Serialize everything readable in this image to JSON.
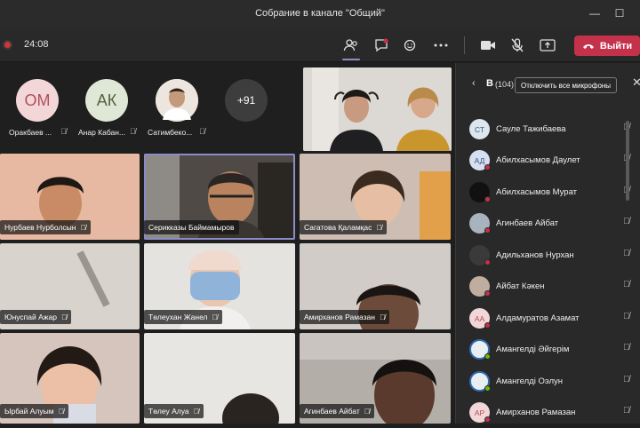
{
  "window": {
    "title": "Собрание в канале \"Общий\"",
    "minimize": "—",
    "maximize": "☐"
  },
  "toolbar": {
    "timer": "24:08",
    "leave_label": "Выйти",
    "icons": [
      "people-icon",
      "chat-icon",
      "reactions-icon",
      "more-icon",
      "camera-icon",
      "mic-off-icon",
      "share-icon"
    ]
  },
  "avatars": [
    {
      "initials": "ОМ",
      "name": "Оракбаев ...",
      "color": "#f3d6d8"
    },
    {
      "initials": "АК",
      "name": "Анар Кабан...",
      "color": "#dfe8d6"
    },
    {
      "initials": "",
      "name": "Сатимбеко...",
      "color": "#e8e0d8"
    },
    {
      "initials": "+91",
      "name": "",
      "color": "#3d3d3d"
    }
  ],
  "tiles": [
    {
      "name": "Нурбаев Нурболсын",
      "bg": "#e8b9a3"
    },
    {
      "name": "Серикказы Баймамыров",
      "bg": "#5e564e"
    },
    {
      "name": "Сагатова Қаламқас",
      "bg": "#c9b8ad"
    },
    {
      "name": "Юнуспай Ажар",
      "bg": "#d9d4cf"
    },
    {
      "name": "Төлеухан Жанел",
      "bg": "#e4e2df"
    },
    {
      "name": "Амирханов Рамазан",
      "bg": "#cfcac6"
    },
    {
      "name": "Ырбай Алуым",
      "bg": "#d9c8c0"
    },
    {
      "name": "Төлеу Алуа",
      "bg": "#e7e4e1"
    },
    {
      "name": "Агинбаев Айбат",
      "bg": "#b9b3ad"
    }
  ],
  "panel": {
    "title": "В",
    "count": "(104)",
    "mute_all": "Отключить все микрофоны",
    "participants": [
      {
        "initials": "СТ",
        "name": "Сауле Тажибаева",
        "color": "#dce6ef",
        "red": false
      },
      {
        "initials": "АД",
        "name": "Абилхасымов Даулет",
        "color": "#d6e0f0",
        "red": true
      },
      {
        "initials": "",
        "name": "Абилхасымов Мурат",
        "color": "#111111",
        "red": true
      },
      {
        "initials": "",
        "name": "Агинбаев Айбат",
        "color": "#a9b3bd",
        "red": true
      },
      {
        "initials": "",
        "name": "Адильханов Нурхан",
        "color": "#3a3a3a",
        "red": true
      },
      {
        "initials": "",
        "name": "Айбат Кәкен",
        "color": "#bfae9f",
        "red": true
      },
      {
        "initials": "АА",
        "name": "Алдамуратов Азамат",
        "color": "#f3d6d8",
        "red": true
      },
      {
        "initials": "",
        "name": "Амангелді Әйгерім",
        "color": "#e9eef3",
        "red": false
      },
      {
        "initials": "",
        "name": "Амангелді Оэлун",
        "color": "#e9eef3",
        "red": false
      },
      {
        "initials": "АР",
        "name": "Амирханов Рамазан",
        "color": "#f3d6d8",
        "red": true
      }
    ]
  }
}
